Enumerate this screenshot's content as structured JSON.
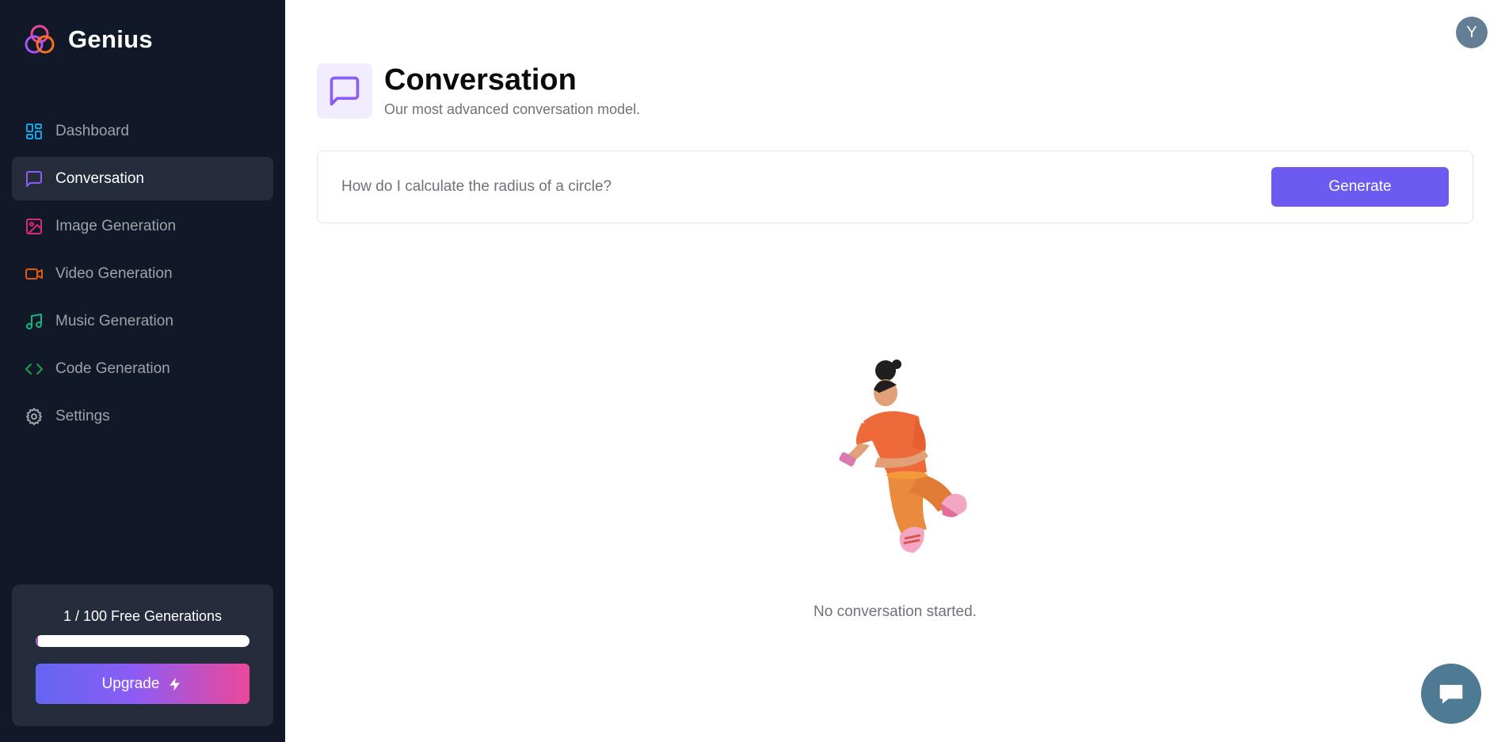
{
  "app": {
    "name": "Genius"
  },
  "sidebar": {
    "items": [
      {
        "label": "Dashboard",
        "icon": "dashboard-icon",
        "color": "#0ea5e9",
        "active": false
      },
      {
        "label": "Conversation",
        "icon": "message-square-icon",
        "color": "#8b5cf6",
        "active": true
      },
      {
        "label": "Image Generation",
        "icon": "image-icon",
        "color": "#db2777",
        "active": false
      },
      {
        "label": "Video Generation",
        "icon": "video-icon",
        "color": "#ea580c",
        "active": false
      },
      {
        "label": "Music Generation",
        "icon": "music-icon",
        "color": "#10b981",
        "active": false
      },
      {
        "label": "Code Generation",
        "icon": "code-icon",
        "color": "#16a34a",
        "active": false
      },
      {
        "label": "Settings",
        "icon": "gear-icon",
        "color": "#a1a1aa",
        "active": false
      }
    ],
    "usage": {
      "text": "1 / 100 Free Generations",
      "used": 1,
      "limit": 100,
      "progress_fraction": 0.01
    },
    "upgrade_label": "Upgrade"
  },
  "header": {
    "avatar_initial": "Y"
  },
  "main": {
    "title": "Conversation",
    "subtitle": "Our most advanced conversation model.",
    "prompt": {
      "placeholder": "How do I calculate the radius of a circle?",
      "value": ""
    },
    "generate_label": "Generate",
    "empty_text": "No conversation started."
  },
  "colors": {
    "sidebar_bg": "#111827",
    "accent": "#6d5af0",
    "heading_icon_bg": "#f1ecfe",
    "chat_fab": "#4f7a93"
  }
}
